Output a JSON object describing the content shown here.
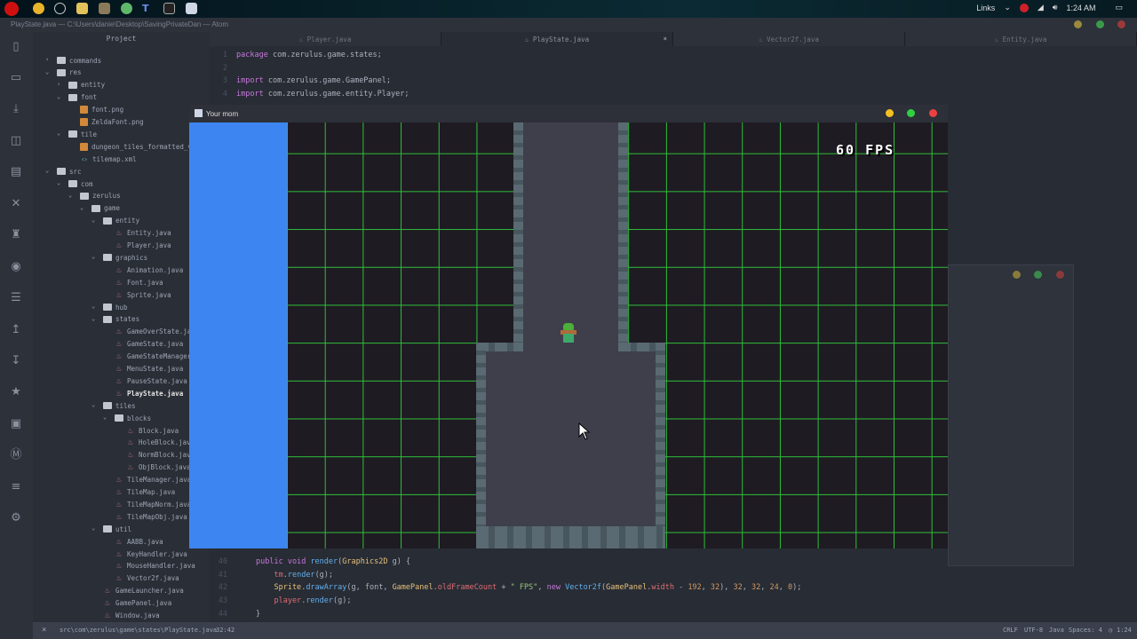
{
  "taskbar": {
    "tray_links": "Links",
    "clock": "1:24 AM"
  },
  "window_title": "PlayState.java — C:\\Users\\danie\\Desktop\\SavingPrivateDan — Atom",
  "tree": {
    "header": "Project",
    "items": [
      {
        "label": "commands",
        "type": "folder",
        "depth": 1,
        "open": false
      },
      {
        "label": "res",
        "type": "folder",
        "depth": 1,
        "open": true
      },
      {
        "label": "entity",
        "type": "folder",
        "depth": 2,
        "open": false
      },
      {
        "label": "font",
        "type": "folder",
        "depth": 2,
        "open": true
      },
      {
        "label": "font.png",
        "type": "image",
        "depth": 3
      },
      {
        "label": "ZeldaFont.png",
        "type": "image",
        "depth": 3
      },
      {
        "label": "tile",
        "type": "folder",
        "depth": 2,
        "open": true
      },
      {
        "label": "dungeon_tiles_formatted_v",
        "type": "image",
        "depth": 3
      },
      {
        "label": "tilemap.xml",
        "type": "xml",
        "depth": 3
      },
      {
        "label": "src",
        "type": "folder",
        "depth": 1,
        "open": true
      },
      {
        "label": "com",
        "type": "folder",
        "depth": 2,
        "open": true
      },
      {
        "label": "zerulus",
        "type": "folder",
        "depth": 3,
        "open": true
      },
      {
        "label": "game",
        "type": "folder",
        "depth": 4,
        "open": true
      },
      {
        "label": "entity",
        "type": "folder",
        "depth": 5,
        "open": true
      },
      {
        "label": "Entity.java",
        "type": "java",
        "depth": 6
      },
      {
        "label": "Player.java",
        "type": "java",
        "depth": 6
      },
      {
        "label": "graphics",
        "type": "folder",
        "depth": 5,
        "open": true
      },
      {
        "label": "Animation.java",
        "type": "java",
        "depth": 6
      },
      {
        "label": "Font.java",
        "type": "java",
        "depth": 6
      },
      {
        "label": "Sprite.java",
        "type": "java",
        "depth": 6
      },
      {
        "label": "hub",
        "type": "folder",
        "depth": 5,
        "open": true
      },
      {
        "label": "states",
        "type": "folder",
        "depth": 5,
        "open": true
      },
      {
        "label": "GameOverState.java",
        "type": "java",
        "depth": 6
      },
      {
        "label": "GameState.java",
        "type": "java",
        "depth": 6
      },
      {
        "label": "GameStateManager.java",
        "type": "java",
        "depth": 6
      },
      {
        "label": "MenuState.java",
        "type": "java",
        "depth": 6
      },
      {
        "label": "PauseState.java",
        "type": "java",
        "depth": 6
      },
      {
        "label": "PlayState.java",
        "type": "java",
        "depth": 6,
        "active": true
      },
      {
        "label": "tiles",
        "type": "folder",
        "depth": 5,
        "open": true
      },
      {
        "label": "blocks",
        "type": "folder",
        "depth": 6,
        "open": true
      },
      {
        "label": "Block.java",
        "type": "java",
        "depth": 7
      },
      {
        "label": "HoleBlock.java",
        "type": "java",
        "depth": 7
      },
      {
        "label": "NormBlock.java",
        "type": "java",
        "depth": 7
      },
      {
        "label": "ObjBlock.java",
        "type": "java",
        "depth": 7
      },
      {
        "label": "TileManager.java",
        "type": "java",
        "depth": 6
      },
      {
        "label": "TileMap.java",
        "type": "java",
        "depth": 6
      },
      {
        "label": "TileMapNorm.java",
        "type": "java",
        "depth": 6
      },
      {
        "label": "TileMapObj.java",
        "type": "java",
        "depth": 6
      },
      {
        "label": "util",
        "type": "folder",
        "depth": 5,
        "open": true
      },
      {
        "label": "AABB.java",
        "type": "java",
        "depth": 6
      },
      {
        "label": "KeyHandler.java",
        "type": "java",
        "depth": 6
      },
      {
        "label": "MouseHandler.java",
        "type": "java",
        "depth": 6
      },
      {
        "label": "Vector2f.java",
        "type": "java",
        "depth": 6
      },
      {
        "label": "GameLauncher.java",
        "type": "java",
        "depth": 5
      },
      {
        "label": "GamePanel.java",
        "type": "java",
        "depth": 5
      },
      {
        "label": "Window.java",
        "type": "java",
        "depth": 5
      }
    ]
  },
  "tabs": [
    {
      "label": "Player.java"
    },
    {
      "label": "PlayState.java",
      "active": true,
      "close": "×"
    },
    {
      "label": "Vector2f.java"
    },
    {
      "label": "Entity.java"
    }
  ],
  "code_top": [
    {
      "n": "1",
      "parts": [
        [
          "kw",
          "package"
        ],
        [
          "",
          "com.zerulus.game.states;"
        ]
      ]
    },
    {
      "n": "2",
      "parts": []
    },
    {
      "n": "3",
      "parts": [
        [
          "kw",
          "import"
        ],
        [
          "",
          "com.zerulus.game.GamePanel;"
        ]
      ]
    },
    {
      "n": "4",
      "parts": [
        [
          "kw",
          "import"
        ],
        [
          "",
          "com.zerulus.game.entity.Player;"
        ]
      ]
    }
  ],
  "code_bottom": [
    {
      "n": "40",
      "parts": [
        [
          "kw",
          "public"
        ],
        [
          "kw",
          " void "
        ],
        [
          "fn",
          "render"
        ],
        [
          "",
          "("
        ],
        [
          "ty",
          "Graphics2D"
        ],
        [
          "",
          " g) {"
        ]
      ]
    },
    {
      "n": "41",
      "parts": [
        [
          "va",
          "    tm"
        ],
        [
          "",
          "."
        ],
        [
          "fn",
          "render"
        ],
        [
          "",
          "(g);"
        ]
      ]
    },
    {
      "n": "42",
      "parts": [
        [
          "ty",
          "    Sprite"
        ],
        [
          "",
          "."
        ],
        [
          "fn",
          "drawArray"
        ],
        [
          "",
          "(g, font, "
        ],
        [
          "ty",
          "GamePanel"
        ],
        [
          "",
          "."
        ],
        [
          "va",
          "oldFrameCount"
        ],
        [
          "",
          " + "
        ],
        [
          "st",
          "\" FPS\""
        ],
        [
          "",
          ", "
        ],
        [
          "kw",
          "new "
        ],
        [
          "fn",
          "Vector2f"
        ],
        [
          "",
          "("
        ],
        [
          "ty",
          "GamePanel"
        ],
        [
          "",
          "."
        ],
        [
          "va",
          "width"
        ],
        [
          "",
          " - "
        ],
        [
          "nu",
          "192"
        ],
        [
          "",
          ", "
        ],
        [
          "nu",
          "32"
        ],
        [
          "",
          "), "
        ],
        [
          "nu",
          "32"
        ],
        [
          "",
          ", "
        ],
        [
          "nu",
          "32"
        ],
        [
          "",
          ", "
        ],
        [
          "nu",
          "24"
        ],
        [
          "",
          ", "
        ],
        [
          "nu",
          "0"
        ],
        [
          "",
          ");"
        ]
      ]
    },
    {
      "n": "43",
      "parts": [
        [
          "va",
          "    player"
        ],
        [
          "",
          "."
        ],
        [
          "fn",
          "render"
        ],
        [
          "",
          "(g);"
        ]
      ]
    },
    {
      "n": "44",
      "parts": [
        [
          "",
          "}"
        ]
      ]
    }
  ],
  "game_window": {
    "title": "Your mom",
    "fps_text": "60 FPS"
  },
  "status": {
    "close": "×",
    "path": "src\\com\\zerulus\\game\\states\\PlayState.java",
    "cursor": "32:42",
    "line_ending": "CRLF",
    "encoding": "UTF-8",
    "grammar": "Java",
    "indent": "Spaces: 4",
    "time": "1:24"
  },
  "colors": {
    "accent_blue": "#3d85f0",
    "grid_green": "#2fbf3a"
  }
}
